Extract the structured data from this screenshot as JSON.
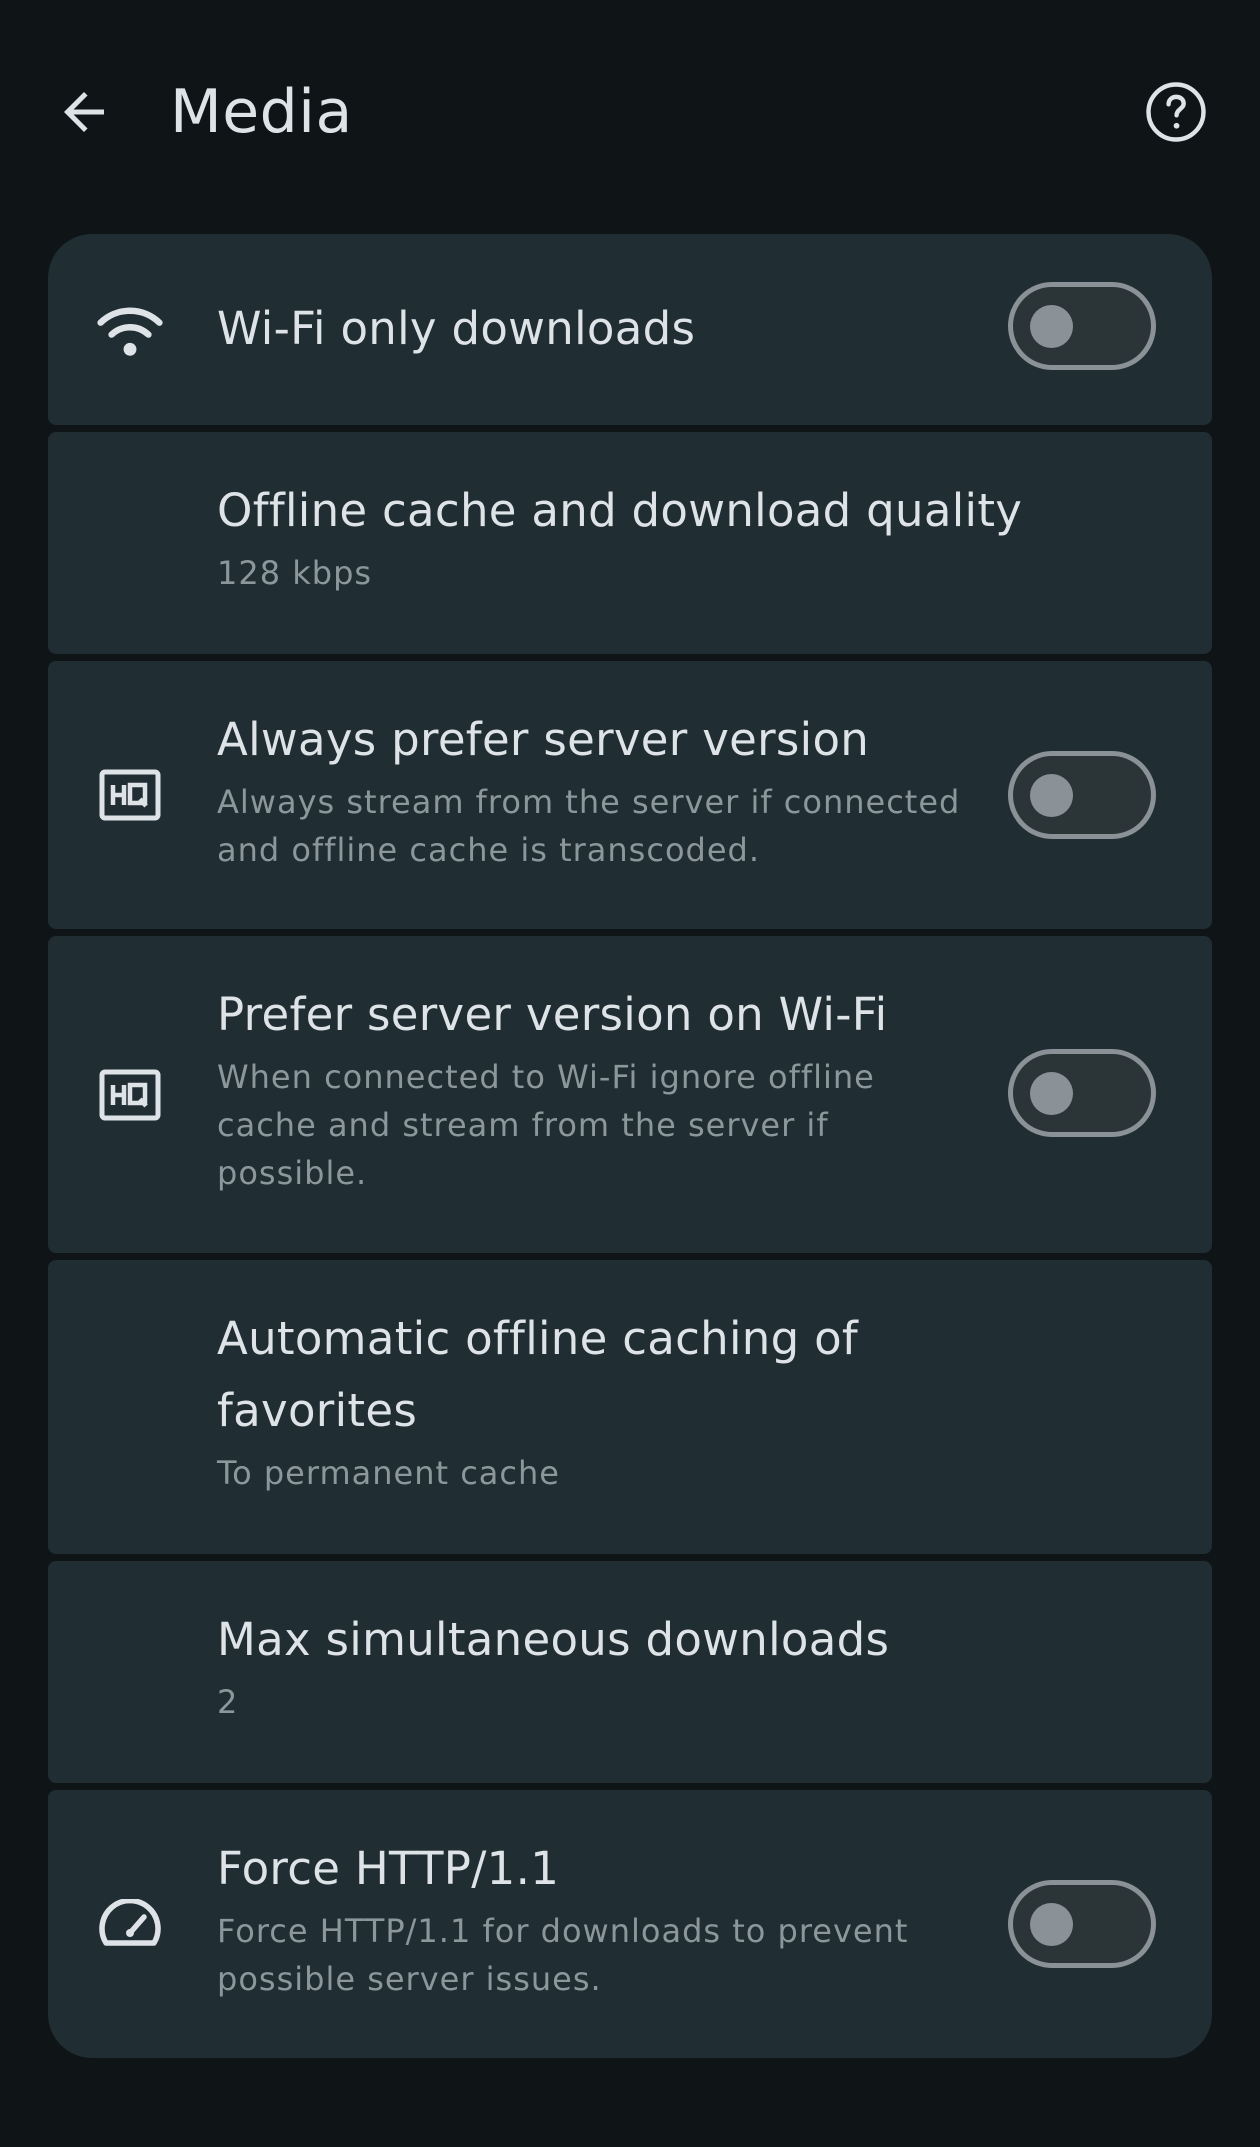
{
  "header": {
    "title": "Media",
    "back_icon": "arrow-back-icon",
    "help_icon": "help-circle-icon"
  },
  "settings": [
    {
      "id": "wifi-only",
      "title": "Wi-Fi only downloads",
      "subtitle": "",
      "icon": "wifi-icon",
      "toggle": false
    },
    {
      "id": "offline-quality",
      "title": "Offline cache and download quality",
      "subtitle": "128 kbps",
      "icon": "",
      "toggle": null
    },
    {
      "id": "prefer-server",
      "title": "Always prefer server version",
      "subtitle_lines": [
        "Always stream from the server if connected",
        "and offline cache is transcoded."
      ],
      "icon": "hq-icon",
      "toggle": false
    },
    {
      "id": "prefer-server-wifi",
      "title": "Prefer server version on Wi-Fi",
      "subtitle_lines": [
        "When connected to Wi-Fi ignore offline",
        "cache and stream from the server if",
        "possible."
      ],
      "icon": "hq-icon",
      "toggle": false
    },
    {
      "id": "auto-cache-favorites",
      "title_lines": [
        "Automatic offline caching of",
        "favorites"
      ],
      "subtitle": "To permanent cache",
      "icon": "",
      "toggle": null
    },
    {
      "id": "max-downloads",
      "title": "Max simultaneous downloads",
      "subtitle": "2",
      "icon": "",
      "toggle": null
    },
    {
      "id": "force-http11",
      "title": "Force HTTP/1.1",
      "subtitle_lines": [
        "Force HTTP/1.1 for downloads to prevent",
        "possible server issues."
      ],
      "icon": "speedometer-icon",
      "toggle": false
    }
  ],
  "colors": {
    "background": "#0f1417",
    "card": "#202d33",
    "text": "#dee3e7",
    "subtext": "#8c979c",
    "toggle_outline": "#8a9297"
  }
}
